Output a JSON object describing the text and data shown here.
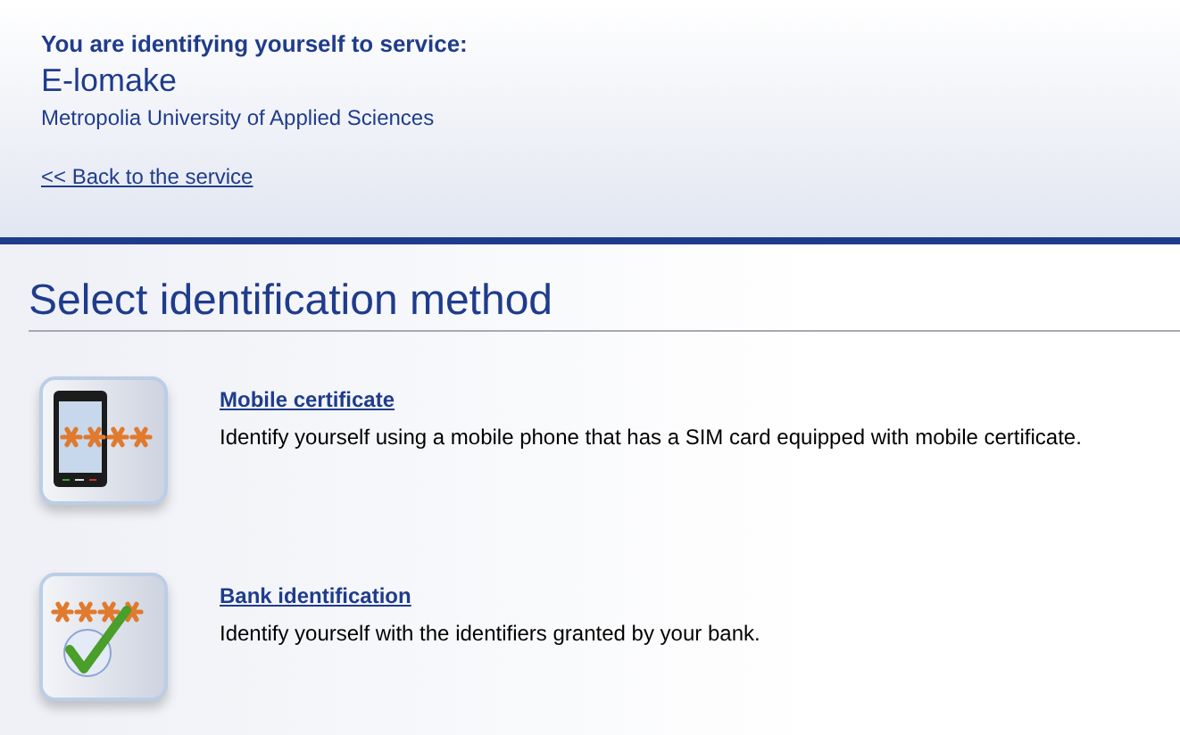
{
  "header": {
    "intro": "You are identifying yourself to service:",
    "service": "E-lomake",
    "organization": "Metropolia University of Applied Sciences",
    "back_link": "<< Back to the service"
  },
  "heading": "Select identification method",
  "methods": [
    {
      "kind": "mobile",
      "title": "Mobile certificate",
      "description": "Identify yourself using a mobile phone that has a SIM card equipped with mobile certificate."
    },
    {
      "kind": "bank",
      "title": "Bank identification",
      "description": "Identify yourself with the identifiers granted by your bank."
    }
  ]
}
